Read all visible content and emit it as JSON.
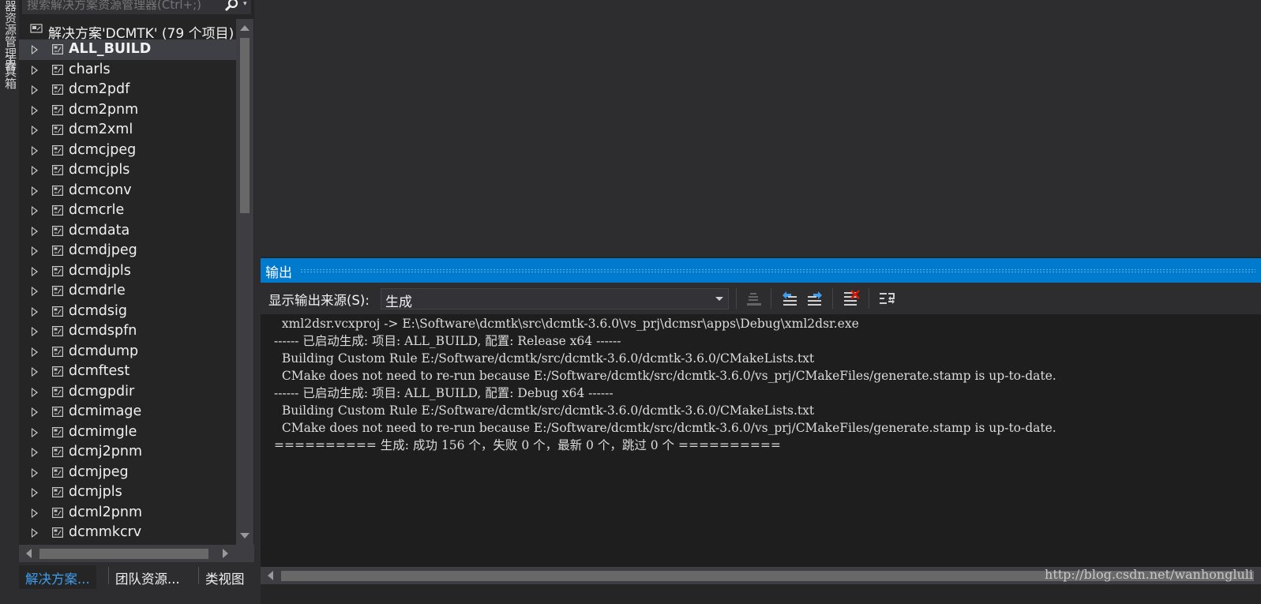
{
  "left_strip": {
    "tabs": [
      "服务器资源管理器",
      "工具箱"
    ]
  },
  "solution_explorer": {
    "search_placeholder": "搜索解决方案资源管理器(Ctrl+;)",
    "solution_label": "解决方案'DCMTK' (79 个项目)",
    "items": [
      {
        "label": "ALL_BUILD",
        "selected": true
      },
      {
        "label": "charls"
      },
      {
        "label": "dcm2pdf"
      },
      {
        "label": "dcm2pnm"
      },
      {
        "label": "dcm2xml"
      },
      {
        "label": "dcmcjpeg"
      },
      {
        "label": "dcmcjpls"
      },
      {
        "label": "dcmconv"
      },
      {
        "label": "dcmcrle"
      },
      {
        "label": "dcmdata"
      },
      {
        "label": "dcmdjpeg"
      },
      {
        "label": "dcmdjpls"
      },
      {
        "label": "dcmdrle"
      },
      {
        "label": "dcmdsig"
      },
      {
        "label": "dcmdspfn"
      },
      {
        "label": "dcmdump"
      },
      {
        "label": "dcmftest"
      },
      {
        "label": "dcmgpdir"
      },
      {
        "label": "dcmimage"
      },
      {
        "label": "dcmimgle"
      },
      {
        "label": "dcmj2pnm"
      },
      {
        "label": "dcmjpeg"
      },
      {
        "label": "dcmjpls"
      },
      {
        "label": "dcml2pnm"
      },
      {
        "label": "dcmmkcrv"
      }
    ],
    "bottom_tabs": [
      "解决方案...",
      "团队资源...",
      "类视图"
    ]
  },
  "output": {
    "title": "输出",
    "source_label": "显示输出来源(S):",
    "source_value": "生成",
    "lines": [
      "  xml2dsr.vcxproj -> E:\\Software\\dcmtk\\src\\dcmtk-3.6.0\\vs_prj\\dcmsr\\apps\\Debug\\xml2dsr.exe",
      "------ 已启动生成: 项目: ALL_BUILD, 配置: Release x64 ------",
      "  Building Custom Rule E:/Software/dcmtk/src/dcmtk-3.6.0/dcmtk-3.6.0/CMakeLists.txt",
      "  CMake does not need to re-run because E:/Software/dcmtk/src/dcmtk-3.6.0/vs_prj/CMakeFiles/generate.stamp is up-to-date.",
      "------ 已启动生成: 项目: ALL_BUILD, 配置: Debug x64 ------",
      "  Building Custom Rule E:/Software/dcmtk/src/dcmtk-3.6.0/dcmtk-3.6.0/CMakeLists.txt",
      "  CMake does not need to re-run because E:/Software/dcmtk/src/dcmtk-3.6.0/vs_prj/CMakeFiles/generate.stamp is up-to-date.",
      "========== 生成: 成功 156 个，失败 0 个，最新 0 个，跳过 0 个 =========="
    ],
    "watermark": "http://blog.csdn.net/wanhongluli"
  },
  "colors": {
    "accent": "#007acc",
    "background": "#252526",
    "output_background": "#1e1e1e",
    "active_tab_text": "#3e9ded"
  },
  "icons": {
    "search": "search-icon",
    "solution": "solution-icon",
    "project": "project-icon",
    "find_message_in_code": "find-message-in-code-icon",
    "previous_message": "previous-message-icon",
    "next_message": "next-message-icon",
    "clear_all": "clear-all-icon",
    "toggle_word_wrap": "toggle-word-wrap-icon"
  }
}
